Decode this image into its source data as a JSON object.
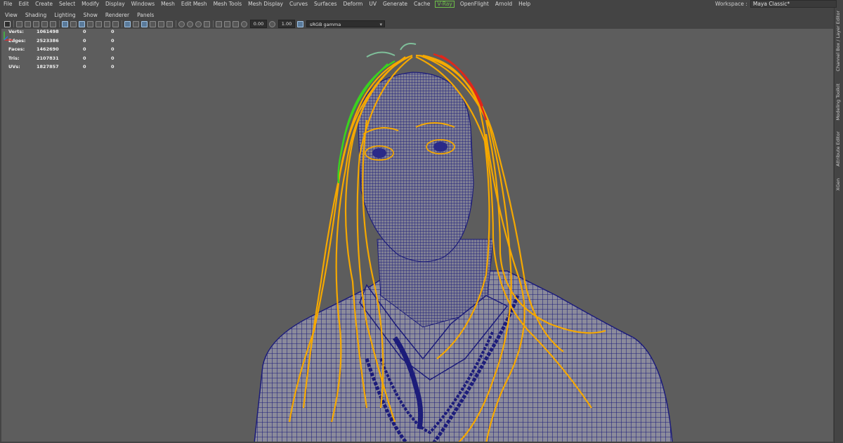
{
  "menubar": {
    "items": [
      "File",
      "Edit",
      "Create",
      "Select",
      "Modify",
      "Display",
      "Windows",
      "Mesh",
      "Edit Mesh",
      "Mesh Tools",
      "Mesh Display",
      "Curves",
      "Surfaces",
      "Deform",
      "UV",
      "Generate",
      "Cache",
      "V-Ray",
      "OpenFlight",
      "Arnold",
      "Help"
    ],
    "workspace_label": "Workspace :",
    "workspace_value": "Maya Classic*"
  },
  "panel_menu": {
    "items": [
      "View",
      "Shading",
      "Lighting",
      "Show",
      "Renderer",
      "Panels"
    ]
  },
  "toolbar": {
    "exposure": "0.00",
    "gamma": "1.00",
    "color_space": "sRGB gamma"
  },
  "hud": {
    "rows": [
      {
        "label": "Verts:",
        "value": "1061498",
        "c2": "0",
        "c3": "0"
      },
      {
        "label": "Edges:",
        "value": "2523386",
        "c2": "0",
        "c3": "0"
      },
      {
        "label": "Faces:",
        "value": "1462690",
        "c2": "0",
        "c3": "0"
      },
      {
        "label": "Tris:",
        "value": "2107831",
        "c2": "0",
        "c3": "0"
      },
      {
        "label": "UVs:",
        "value": "1827857",
        "c2": "0",
        "c3": "0"
      }
    ]
  },
  "side_tabs": [
    "Channel Box / Layer Editor",
    "Modeling Toolkit",
    "Attribute Editor",
    "XGen"
  ],
  "colors": {
    "viewport_bg": "#5d5d5d",
    "wire": "#1c1c7a",
    "hair": "#f5a800",
    "hair_green": "#3bd21f",
    "hair_red": "#e0261a"
  }
}
